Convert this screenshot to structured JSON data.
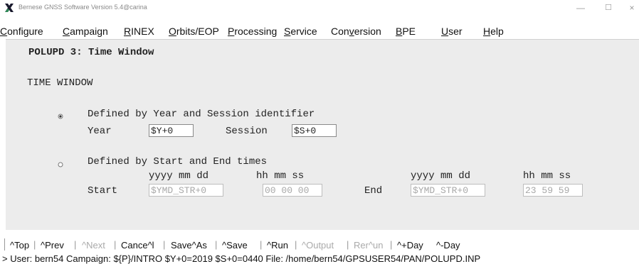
{
  "window": {
    "title": "Bernese GNSS Software Version 5.4@carina",
    "minimize": "—",
    "maximize": "☐",
    "close": "×"
  },
  "menu": [
    {
      "pre": "",
      "ul": "C",
      "post": "onfigure"
    },
    {
      "pre": "",
      "ul": "C",
      "post": "ampaign"
    },
    {
      "pre": "",
      "ul": "R",
      "post": "INEX"
    },
    {
      "pre": "",
      "ul": "O",
      "post": "rbits/EOP"
    },
    {
      "pre": "",
      "ul": "P",
      "post": "rocessing"
    },
    {
      "pre": "",
      "ul": "S",
      "post": "ervice"
    },
    {
      "pre": "Con",
      "ul": "v",
      "post": "ersion"
    },
    {
      "pre": "",
      "ul": "B",
      "post": "PE"
    },
    {
      "pre": "",
      "ul": "U",
      "post": "ser"
    },
    {
      "pre": "",
      "ul": "H",
      "post": "elp"
    }
  ],
  "panel": {
    "title": "POLUPD 3: Time Window",
    "section": "TIME WINDOW",
    "option1": {
      "label": "Defined by Year and Session identifier",
      "selected": true,
      "year_label": "Year",
      "year_value": "$Y+0",
      "session_label": "Session",
      "session_value": "$S+0"
    },
    "option2": {
      "label": "Defined by Start and End times",
      "selected": false,
      "date_header": "yyyy mm dd",
      "time_header": "hh mm ss",
      "start_label": "Start",
      "start_date": "$YMD_STR+0",
      "start_time": "00 00 00",
      "end_label": "End",
      "end_date": "$YMD_STR+0",
      "end_time": "23 59 59"
    }
  },
  "toolbar": {
    "top": "^Top",
    "prev": "^Prev",
    "next": "^Next",
    "cancel": "Cance^l",
    "saveas": "Save^As",
    "save": "^Save",
    "run": "^Run",
    "output": "^Output",
    "rerun": "Rer^un",
    "plusday": "^+Day",
    "minusday": "^-Day",
    "separator": "|"
  },
  "status": "> User: bern54  Campaign: ${P}/INTRO  $Y+0=2019  $S+0=0440  File: /home/bern54/GPSUSER54/PAN/POLUPD.INP"
}
